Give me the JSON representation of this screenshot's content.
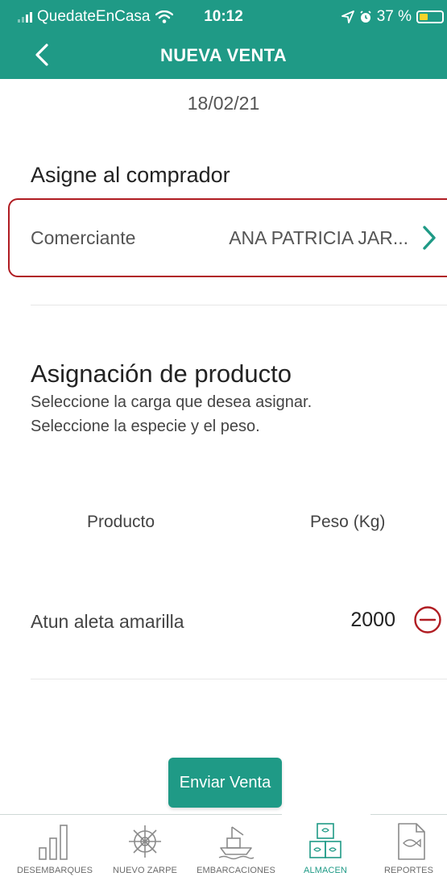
{
  "status_bar": {
    "carrier": "QuedateEnCasa",
    "time": "10:12",
    "battery": "37 %",
    "battery_level": 0.37
  },
  "nav": {
    "title": "NUEVA VENTA"
  },
  "date": "18/02/21",
  "buyer": {
    "section_title": "Asigne al comprador",
    "label": "Comerciante",
    "value": "ANA PATRICIA JAR..."
  },
  "product": {
    "section_title": "Asignación de producto",
    "subtitle_1": "Seleccione la carga que desea asignar.",
    "subtitle_2": "Seleccione la especie y el peso.",
    "col_product": "Producto",
    "col_weight": "Peso (Kg)",
    "items": [
      {
        "name": "Atun aleta amarilla",
        "weight": "2000"
      }
    ]
  },
  "actions": {
    "send_label": "Enviar Venta"
  },
  "colors": {
    "brand": "#1f9a86",
    "alert": "#b01c22"
  },
  "tabbar": {
    "active": "almacen",
    "tabs": [
      {
        "id": "desembarques",
        "label": "DESEMBARQUES",
        "icon": "bar-chart-icon"
      },
      {
        "id": "nuevo_zarpe",
        "label": "NUEVO ZARPE",
        "icon": "ship-wheel-icon"
      },
      {
        "id": "embarcaciones",
        "label": "EMBARCACIONES",
        "icon": "boat-icon"
      },
      {
        "id": "almacen",
        "label": "ALMACEN",
        "icon": "boxes-icon"
      },
      {
        "id": "reportes",
        "label": "REPORTES",
        "icon": "fish-document-icon"
      }
    ]
  }
}
